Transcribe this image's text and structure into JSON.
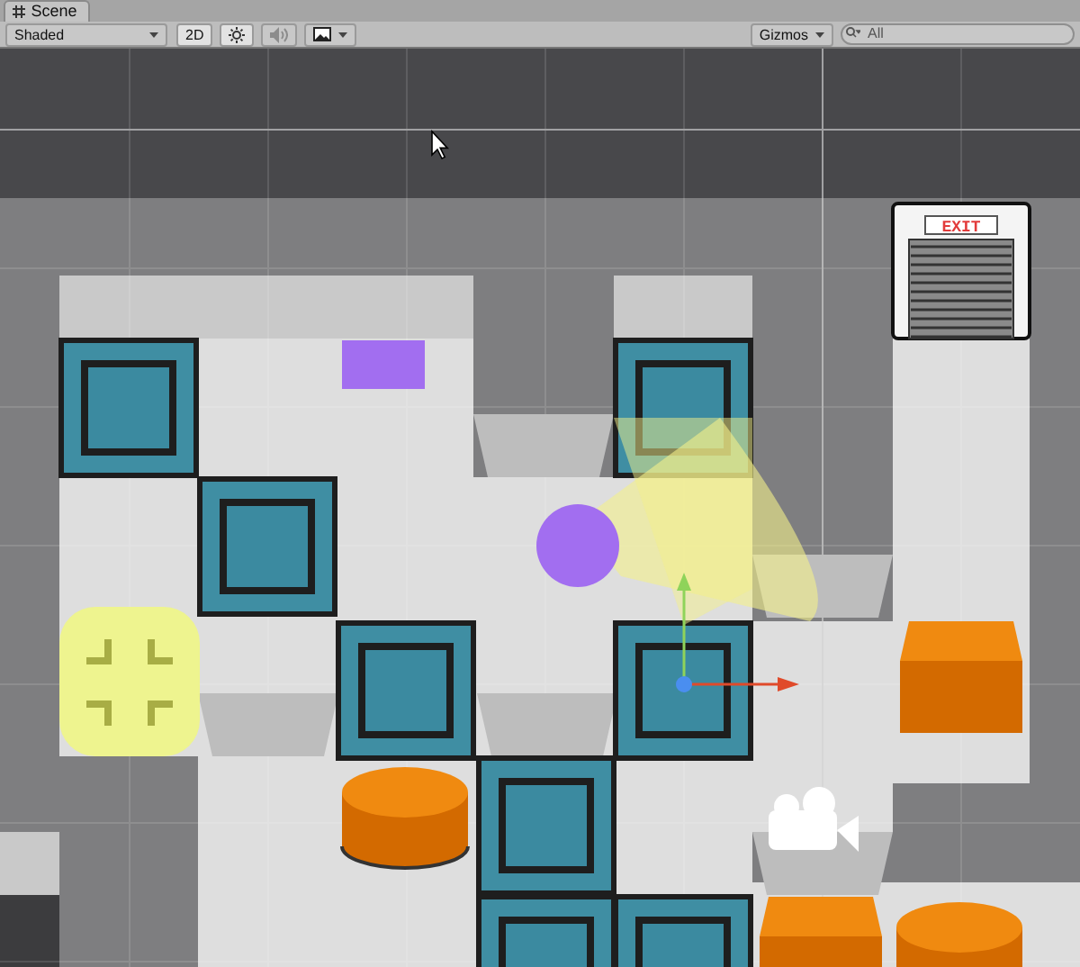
{
  "tab": {
    "label": "Scene",
    "selected": true
  },
  "toolbar": {
    "draw_mode": "Shaded",
    "toggles": [
      {
        "kind": "dimension",
        "label": "2D",
        "on": true,
        "disabled": false
      },
      {
        "kind": "lighting",
        "on": true,
        "disabled": false
      },
      {
        "kind": "audio",
        "on": false,
        "disabled": true
      },
      {
        "kind": "effects",
        "on": false,
        "disabled": false
      }
    ],
    "gizmos": "Gizmos",
    "search": {
      "placeholder": "All"
    }
  },
  "scene": {
    "exit_sign": "EXIT"
  }
}
